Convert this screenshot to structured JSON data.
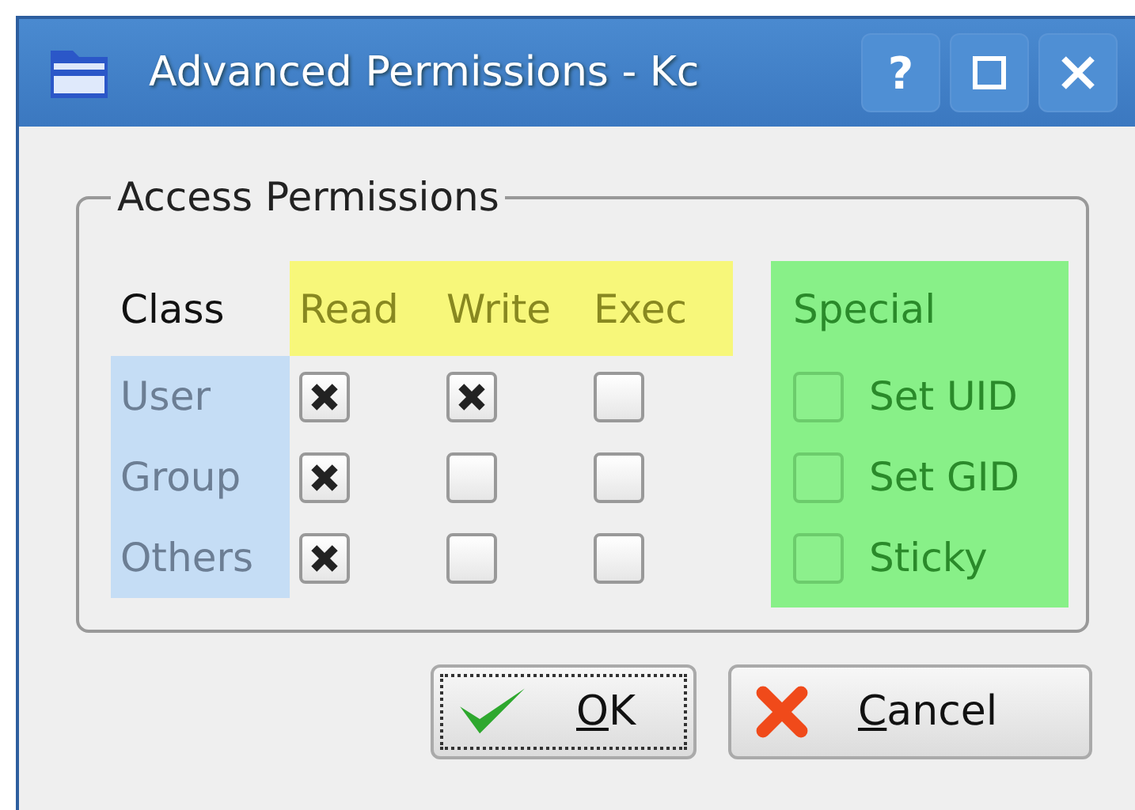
{
  "window": {
    "title": "Advanced Permissions - Kc",
    "help_button": "?"
  },
  "group": {
    "title": "Access Permissions"
  },
  "header": {
    "class": "Class",
    "permissions": [
      "Read",
      "Write",
      "Exec"
    ],
    "special": "Special"
  },
  "rows": [
    {
      "label": "User",
      "permissions": [
        {
          "checked": true
        },
        {
          "checked": true
        },
        {
          "checked": false
        }
      ]
    },
    {
      "label": "Group",
      "permissions": [
        {
          "checked": true
        },
        {
          "checked": false
        },
        {
          "checked": false
        }
      ]
    },
    {
      "label": "Others",
      "permissions": [
        {
          "checked": true
        },
        {
          "checked": false
        },
        {
          "checked": false
        }
      ]
    }
  ],
  "special": [
    {
      "label": "Set UID",
      "checked": false
    },
    {
      "label": "Set GID",
      "checked": false
    },
    {
      "label": "Sticky",
      "checked": false
    }
  ],
  "buttons": [
    {
      "label": "OK",
      "kind": "ok",
      "focused": true
    },
    {
      "label": "Cancel",
      "kind": "cancel",
      "focused": false
    }
  ]
}
